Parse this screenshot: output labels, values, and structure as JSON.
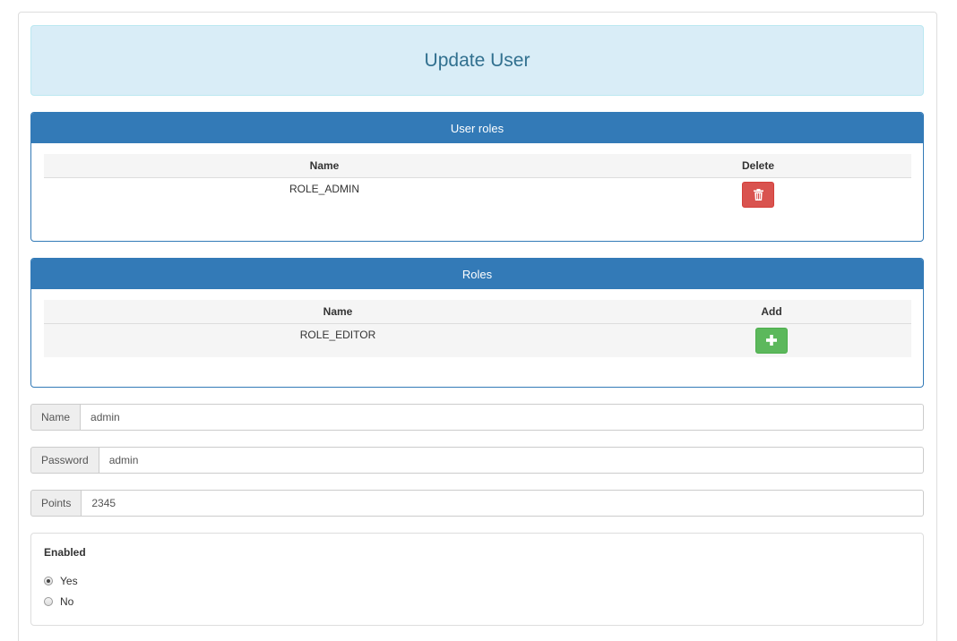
{
  "page": {
    "title": "Update User"
  },
  "user_roles_panel": {
    "heading": "User roles",
    "columns": {
      "name": "Name",
      "action": "Delete"
    },
    "rows": [
      {
        "name": "ROLE_ADMIN",
        "action_icon": "trash-icon"
      }
    ]
  },
  "roles_panel": {
    "heading": "Roles",
    "columns": {
      "name": "Name",
      "action": "Add"
    },
    "rows": [
      {
        "name": "ROLE_EDITOR",
        "action_icon": "plus-icon"
      }
    ]
  },
  "form": {
    "name": {
      "label": "Name",
      "value": "admin"
    },
    "password": {
      "label": "Password",
      "value": "admin"
    },
    "points": {
      "label": "Points",
      "value": "2345"
    }
  },
  "enabled": {
    "legend": "Enabled",
    "options": [
      {
        "label": "Yes",
        "checked": true
      },
      {
        "label": "No",
        "checked": false
      }
    ]
  },
  "colors": {
    "primary": "#337ab7",
    "danger": "#d9534f",
    "success": "#5cb85c",
    "info_bg": "#d9edf7",
    "info_text": "#31708f"
  }
}
